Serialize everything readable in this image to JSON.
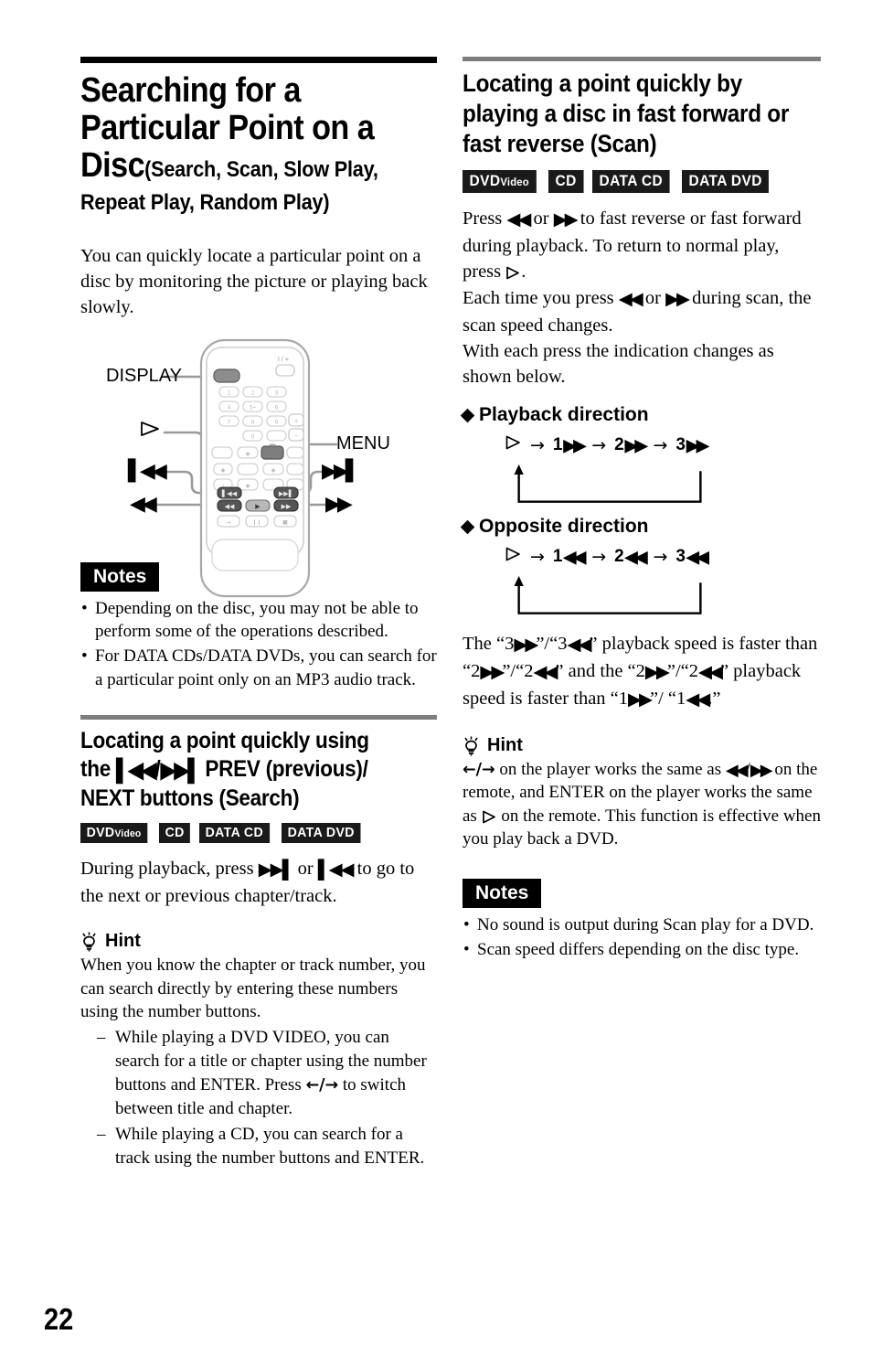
{
  "page": {
    "number": "22"
  },
  "left": {
    "title_line1": "Searching for a",
    "title_line2": "Particular Point on a",
    "title_line3_main": "Disc",
    "title_line3_sub": "(Search, Scan, Slow Play,",
    "title_line4": "Repeat Play, Random Play)",
    "intro": "You can quickly locate a particular point on a disc by monitoring the picture or playing back slowly.",
    "figure": {
      "callouts": {
        "display": "DISPLAY",
        "menu": "MENU",
        "play": "play-triangle",
        "prev": "prev-track",
        "next": "next-track",
        "rewind": "fast-reverse",
        "forward": "fast-forward"
      },
      "power_label": "I / ∂",
      "keys": [
        "1",
        "2",
        "3",
        "4",
        "5+",
        "6",
        "7",
        "8",
        "9",
        "0"
      ],
      "plus": "+",
      "minus": "–"
    },
    "notes_label": "Notes",
    "notes": [
      "Depending on the disc, you may not be able to perform some of the operations described.",
      "For DATA CDs/DATA DVDs, you can search for a particular point only on an MP3 audio track."
    ],
    "section2": {
      "heading_a": "Locating a point quickly using",
      "heading_b_pre": "the ",
      "heading_b_post": " PREV (previous)/",
      "heading_c": "NEXT buttons (Search)",
      "badges": [
        {
          "main": "DVD",
          "tiny": "Video"
        },
        {
          "main": "CD",
          "tiny": ""
        },
        {
          "main": "DATA CD",
          "tiny": ""
        },
        {
          "main": "DATA DVD",
          "tiny": ""
        }
      ],
      "body_pre": "During playback, press ",
      "body_mid": " or ",
      "body_post": " to go to the next or previous chapter/track.",
      "hint_label": "Hint",
      "hint_body": "When you know the chapter or track number, you can search directly by entering these numbers using the number buttons.",
      "dashes": [
        {
          "pre": "While playing a DVD VIDEO, you can search for a title or chapter using the number buttons and ENTER. Press ",
          "post": " to switch between title and chapter."
        },
        {
          "pre": "While playing a CD, you can search for a track using the number buttons and ENTER.",
          "post": ""
        }
      ]
    }
  },
  "right": {
    "heading_line1": "Locating a point quickly by",
    "heading_line2": "playing a disc in fast forward or",
    "heading_line3": "fast reverse (Scan)",
    "badges": [
      {
        "main": "DVD",
        "tiny": "Video"
      },
      {
        "main": "CD",
        "tiny": ""
      },
      {
        "main": "DATA CD",
        "tiny": ""
      },
      {
        "main": "DATA DVD",
        "tiny": ""
      }
    ],
    "body": {
      "p1_a": "Press ",
      "p1_b": " or ",
      "p1_c": " to fast reverse or fast forward during playback. To return to normal play, press ",
      "p1_d": ".",
      "p2_a": "Each time you press ",
      "p2_b": " or ",
      "p2_c": " during scan, the scan speed changes.",
      "p3": "With each press the indication changes as shown below."
    },
    "playback_direction": {
      "label": "Playback direction",
      "steps": [
        "play",
        "1",
        "2",
        "3"
      ],
      "glyph": "fast-forward"
    },
    "opposite_direction": {
      "label": "Opposite direction",
      "steps": [
        "play",
        "1",
        "2",
        "3"
      ],
      "glyph": "fast-reverse"
    },
    "speed_note": {
      "a": "The “3",
      "b": "”/“3",
      "c": "” playback speed is faster than “2",
      "d": "”/“2",
      "e": "” and the “2",
      "f": "”/“2",
      "g": "” playback speed is faster than “1",
      "h": "”/ “1",
      "i": ".”"
    },
    "hint_label": "Hint",
    "hint": {
      "a": "←/→ on the player works the same as ",
      "b": "/",
      "c": " on the remote, and ENTER on the player works the same as ",
      "d": " on the remote. This function is effective when you play back a DVD."
    },
    "notes_label": "Notes",
    "notes": [
      "No sound is output during Scan play for a DVD.",
      "Scan speed differs depending on the disc type."
    ]
  }
}
